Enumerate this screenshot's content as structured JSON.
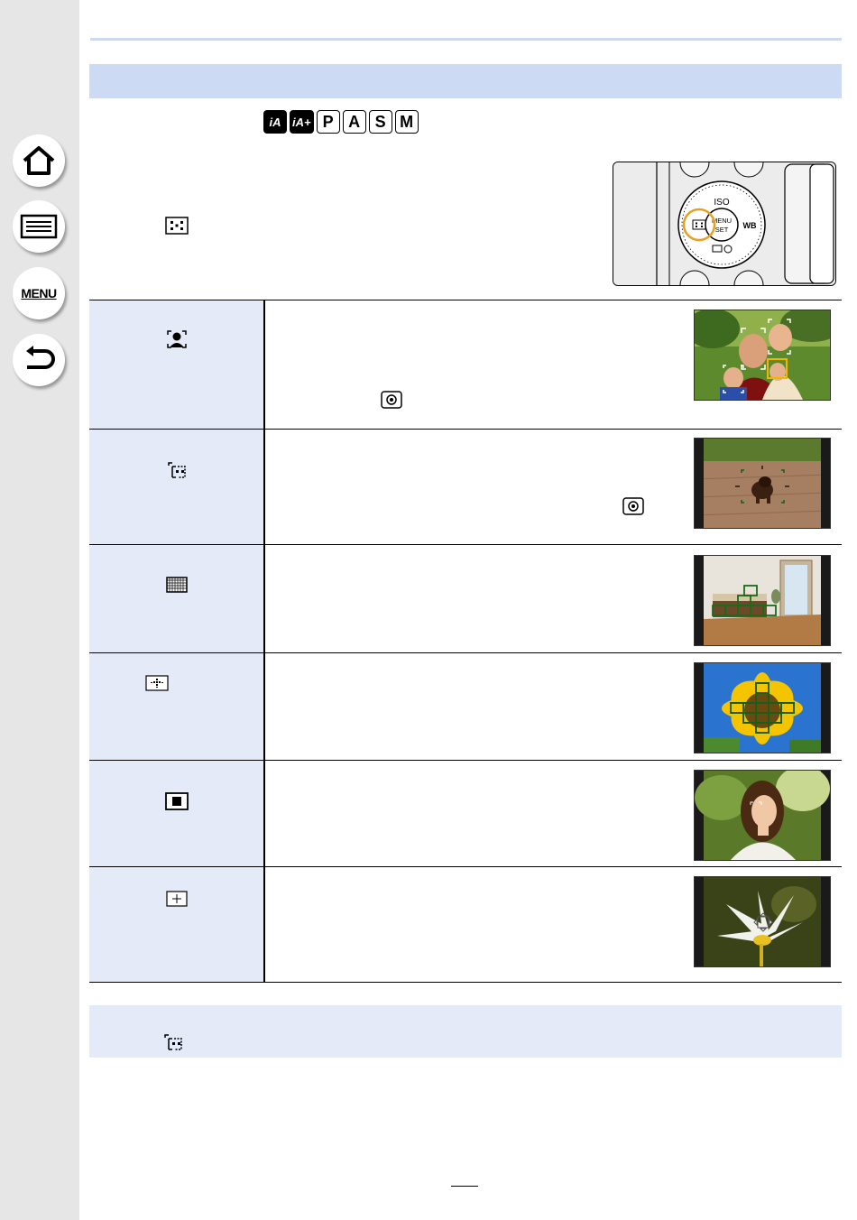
{
  "sidebar": {
    "buttons": [
      {
        "name": "home",
        "icon": "home-icon"
      },
      {
        "name": "contents",
        "icon": "list-icon"
      },
      {
        "name": "menu",
        "label": "MENU"
      },
      {
        "name": "back",
        "icon": "back-arrow-icon"
      }
    ]
  },
  "modes": [
    {
      "label": "iA",
      "type": "ia"
    },
    {
      "label": "iA+",
      "type": "ia"
    },
    {
      "label": "P"
    },
    {
      "label": "A"
    },
    {
      "label": "S"
    },
    {
      "label": "M"
    }
  ],
  "camera_dial": {
    "labels": {
      "top": "ISO",
      "center_top": "MENU",
      "center_bottom": "SET",
      "right": "WB"
    }
  },
  "af_rows": [
    {
      "icon": "face-eye-detection-icon",
      "has_inline_icon": true,
      "thumb": "family-photo"
    },
    {
      "icon": "tracking-icon",
      "has_inline_icon": true,
      "thumb": "dog-photo"
    },
    {
      "icon": "49-area-icon",
      "has_inline_icon": false,
      "thumb": "room-photo"
    },
    {
      "icon": "custom-multi-icon",
      "has_inline_icon": false,
      "thumb": "sunflower-photo"
    },
    {
      "icon": "1-area-icon",
      "has_inline_icon": false,
      "thumb": "woman-photo"
    },
    {
      "icon": "pinpoint-icon",
      "has_inline_icon": false,
      "thumb": "flower-photo"
    }
  ],
  "colors": {
    "accent_circle": "#e8a020",
    "af_frame_green": "#1a6b1a",
    "af_frame_yellow": "#f2b600"
  }
}
